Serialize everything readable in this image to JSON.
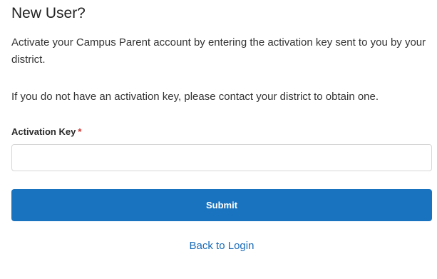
{
  "page": {
    "title": "New User?",
    "paragraph_1": "Activate your Campus Parent account by entering the activation key sent to you by your district.",
    "paragraph_2": "If you do not have an activation key, please contact your district to obtain one."
  },
  "form": {
    "activation_key_label": "Activation Key",
    "required_marker": "*",
    "activation_key_value": "",
    "activation_key_placeholder": "",
    "submit_label": "Submit"
  },
  "links": {
    "back_to_login": "Back to Login"
  },
  "colors": {
    "primary": "#1a73bf",
    "link": "#1a6bb8",
    "required": "#d0312d"
  }
}
